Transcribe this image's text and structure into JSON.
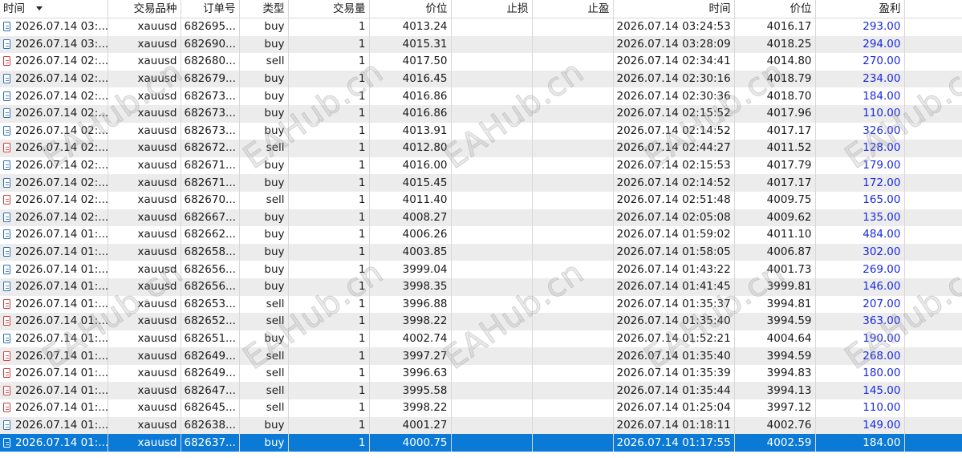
{
  "columns": {
    "open_time": "时间",
    "symbol": "交易品种",
    "order": "订单号",
    "type": "类型",
    "volume": "交易量",
    "open_price": "价位",
    "sl": "止损",
    "tp": "止盈",
    "close_time": "时间",
    "close_price": "价位",
    "profit": "盈利"
  },
  "watermark_text": "EAHub.cn",
  "icons": {
    "buy": "document-icon-blue",
    "sell": "document-icon-red"
  },
  "rows": [
    {
      "open_time": "2026.07.14 03:...",
      "symbol": "xauusd",
      "order": "682695...",
      "type": "buy",
      "volume": "1",
      "open_price": "4013.24",
      "sl": "",
      "tp": "",
      "close_time": "2026.07.14 03:24:53",
      "close_price": "4016.17",
      "profit": "293.00"
    },
    {
      "open_time": "2026.07.14 03:...",
      "symbol": "xauusd",
      "order": "682690...",
      "type": "buy",
      "volume": "1",
      "open_price": "4015.31",
      "sl": "",
      "tp": "",
      "close_time": "2026.07.14 03:28:09",
      "close_price": "4018.25",
      "profit": "294.00"
    },
    {
      "open_time": "2026.07.14 02:...",
      "symbol": "xauusd",
      "order": "682680...",
      "type": "sell",
      "volume": "1",
      "open_price": "4017.50",
      "sl": "",
      "tp": "",
      "close_time": "2026.07.14 02:34:41",
      "close_price": "4014.80",
      "profit": "270.00"
    },
    {
      "open_time": "2026.07.14 02:...",
      "symbol": "xauusd",
      "order": "682679...",
      "type": "buy",
      "volume": "1",
      "open_price": "4016.45",
      "sl": "",
      "tp": "",
      "close_time": "2026.07.14 02:30:16",
      "close_price": "4018.79",
      "profit": "234.00"
    },
    {
      "open_time": "2026.07.14 02:...",
      "symbol": "xauusd",
      "order": "682673...",
      "type": "buy",
      "volume": "1",
      "open_price": "4016.86",
      "sl": "",
      "tp": "",
      "close_time": "2026.07.14 02:30:36",
      "close_price": "4018.70",
      "profit": "184.00"
    },
    {
      "open_time": "2026.07.14 02:...",
      "symbol": "xauusd",
      "order": "682673...",
      "type": "buy",
      "volume": "1",
      "open_price": "4016.86",
      "sl": "",
      "tp": "",
      "close_time": "2026.07.14 02:15:52",
      "close_price": "4017.96",
      "profit": "110.00"
    },
    {
      "open_time": "2026.07.14 02:...",
      "symbol": "xauusd",
      "order": "682673...",
      "type": "buy",
      "volume": "1",
      "open_price": "4013.91",
      "sl": "",
      "tp": "",
      "close_time": "2026.07.14 02:14:52",
      "close_price": "4017.17",
      "profit": "326.00"
    },
    {
      "open_time": "2026.07.14 02:...",
      "symbol": "xauusd",
      "order": "682672...",
      "type": "sell",
      "volume": "1",
      "open_price": "4012.80",
      "sl": "",
      "tp": "",
      "close_time": "2026.07.14 02:44:27",
      "close_price": "4011.52",
      "profit": "128.00"
    },
    {
      "open_time": "2026.07.14 02:...",
      "symbol": "xauusd",
      "order": "682671...",
      "type": "buy",
      "volume": "1",
      "open_price": "4016.00",
      "sl": "",
      "tp": "",
      "close_time": "2026.07.14 02:15:53",
      "close_price": "4017.79",
      "profit": "179.00"
    },
    {
      "open_time": "2026.07.14 02:...",
      "symbol": "xauusd",
      "order": "682671...",
      "type": "buy",
      "volume": "1",
      "open_price": "4015.45",
      "sl": "",
      "tp": "",
      "close_time": "2026.07.14 02:14:52",
      "close_price": "4017.17",
      "profit": "172.00"
    },
    {
      "open_time": "2026.07.14 02:...",
      "symbol": "xauusd",
      "order": "682670...",
      "type": "sell",
      "volume": "1",
      "open_price": "4011.40",
      "sl": "",
      "tp": "",
      "close_time": "2026.07.14 02:51:48",
      "close_price": "4009.75",
      "profit": "165.00"
    },
    {
      "open_time": "2026.07.14 02:...",
      "symbol": "xauusd",
      "order": "682667...",
      "type": "buy",
      "volume": "1",
      "open_price": "4008.27",
      "sl": "",
      "tp": "",
      "close_time": "2026.07.14 02:05:08",
      "close_price": "4009.62",
      "profit": "135.00"
    },
    {
      "open_time": "2026.07.14 01:...",
      "symbol": "xauusd",
      "order": "682662...",
      "type": "buy",
      "volume": "1",
      "open_price": "4006.26",
      "sl": "",
      "tp": "",
      "close_time": "2026.07.14 01:59:02",
      "close_price": "4011.10",
      "profit": "484.00"
    },
    {
      "open_time": "2026.07.14 01:...",
      "symbol": "xauusd",
      "order": "682658...",
      "type": "buy",
      "volume": "1",
      "open_price": "4003.85",
      "sl": "",
      "tp": "",
      "close_time": "2026.07.14 01:58:05",
      "close_price": "4006.87",
      "profit": "302.00"
    },
    {
      "open_time": "2026.07.14 01:...",
      "symbol": "xauusd",
      "order": "682656...",
      "type": "buy",
      "volume": "1",
      "open_price": "3999.04",
      "sl": "",
      "tp": "",
      "close_time": "2026.07.14 01:43:22",
      "close_price": "4001.73",
      "profit": "269.00"
    },
    {
      "open_time": "2026.07.14 01:...",
      "symbol": "xauusd",
      "order": "682656...",
      "type": "buy",
      "volume": "1",
      "open_price": "3998.35",
      "sl": "",
      "tp": "",
      "close_time": "2026.07.14 01:41:45",
      "close_price": "3999.81",
      "profit": "146.00"
    },
    {
      "open_time": "2026.07.14 01:...",
      "symbol": "xauusd",
      "order": "682653...",
      "type": "sell",
      "volume": "1",
      "open_price": "3996.88",
      "sl": "",
      "tp": "",
      "close_time": "2026.07.14 01:35:37",
      "close_price": "3994.81",
      "profit": "207.00"
    },
    {
      "open_time": "2026.07.14 01:...",
      "symbol": "xauusd",
      "order": "682652...",
      "type": "sell",
      "volume": "1",
      "open_price": "3998.22",
      "sl": "",
      "tp": "",
      "close_time": "2026.07.14 01:35:40",
      "close_price": "3994.59",
      "profit": "363.00"
    },
    {
      "open_time": "2026.07.14 01:...",
      "symbol": "xauusd",
      "order": "682651...",
      "type": "buy",
      "volume": "1",
      "open_price": "4002.74",
      "sl": "",
      "tp": "",
      "close_time": "2026.07.14 01:52:21",
      "close_price": "4004.64",
      "profit": "190.00"
    },
    {
      "open_time": "2026.07.14 01:...",
      "symbol": "xauusd",
      "order": "682649...",
      "type": "sell",
      "volume": "1",
      "open_price": "3997.27",
      "sl": "",
      "tp": "",
      "close_time": "2026.07.14 01:35:40",
      "close_price": "3994.59",
      "profit": "268.00"
    },
    {
      "open_time": "2026.07.14 01:...",
      "symbol": "xauusd",
      "order": "682649...",
      "type": "sell",
      "volume": "1",
      "open_price": "3996.63",
      "sl": "",
      "tp": "",
      "close_time": "2026.07.14 01:35:39",
      "close_price": "3994.83",
      "profit": "180.00"
    },
    {
      "open_time": "2026.07.14 01:...",
      "symbol": "xauusd",
      "order": "682647...",
      "type": "sell",
      "volume": "1",
      "open_price": "3995.58",
      "sl": "",
      "tp": "",
      "close_time": "2026.07.14 01:35:44",
      "close_price": "3994.13",
      "profit": "145.00"
    },
    {
      "open_time": "2026.07.14 01:...",
      "symbol": "xauusd",
      "order": "682645...",
      "type": "sell",
      "volume": "1",
      "open_price": "3998.22",
      "sl": "",
      "tp": "",
      "close_time": "2026.07.14 01:25:04",
      "close_price": "3997.12",
      "profit": "110.00"
    },
    {
      "open_time": "2026.07.14 01:...",
      "symbol": "xauusd",
      "order": "682638...",
      "type": "buy",
      "volume": "1",
      "open_price": "4001.27",
      "sl": "",
      "tp": "",
      "close_time": "2026.07.14 01:18:11",
      "close_price": "4002.76",
      "profit": "149.00"
    },
    {
      "open_time": "2026.07.14 01:...",
      "symbol": "xauusd",
      "order": "682637...",
      "type": "buy",
      "volume": "1",
      "open_price": "4000.75",
      "sl": "",
      "tp": "",
      "close_time": "2026.07.14 01:17:55",
      "close_price": "4002.59",
      "profit": "184.00",
      "selected": true
    }
  ],
  "colors": {
    "header_bg": "#ffffff",
    "row_alt_bg": "#ececec",
    "selected_bg": "#0a7ad6",
    "profit_text": "#1a2ae0",
    "buy_icon": "#2f6fb5",
    "sell_icon": "#d83b3b"
  }
}
